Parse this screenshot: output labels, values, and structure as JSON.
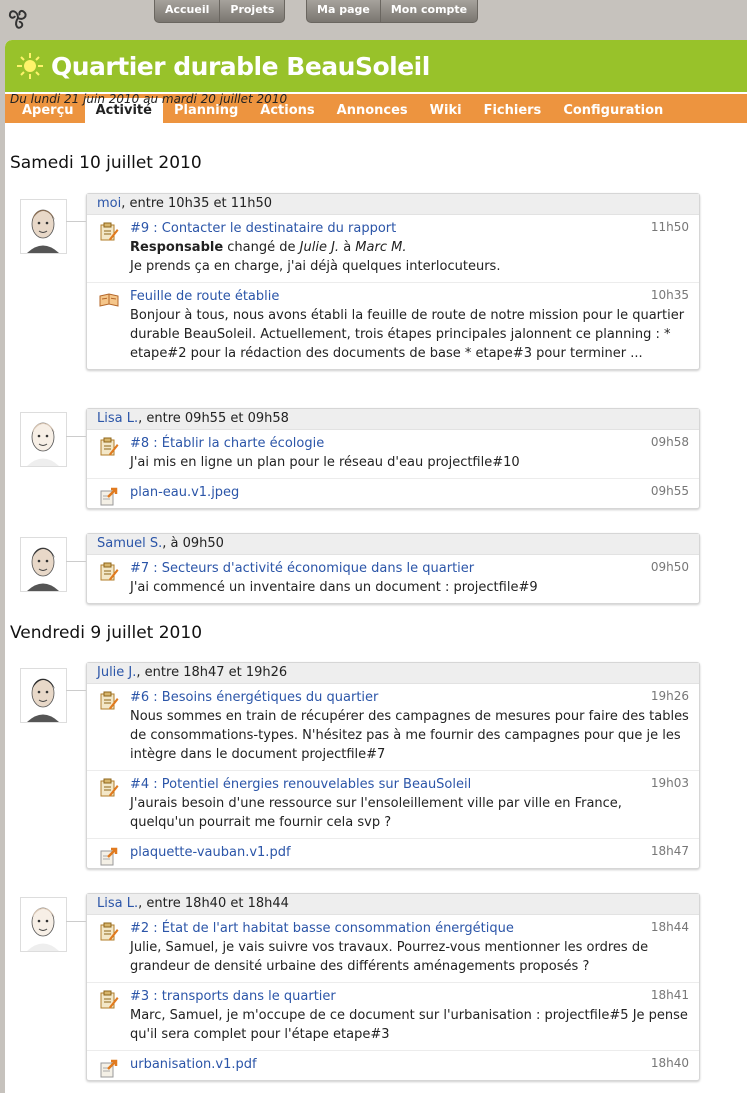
{
  "topnav": {
    "home": "Accueil",
    "projects": "Projets",
    "mypage": "Ma page",
    "account": "Mon compte"
  },
  "header": {
    "title": "Quartier durable BeauSoleil"
  },
  "tabs": [
    "Aperçu",
    "Activité",
    "Planning",
    "Actions",
    "Annonces",
    "Wiki",
    "Fichiers",
    "Configuration"
  ],
  "date_range": "Du lundi 21 juin 2010 au mardi 20 juillet 2010",
  "days": [
    {
      "label": "Samedi 10 juillet 2010",
      "groups": [
        {
          "user": "moi",
          "span": ", entre 10h35 et 11h50",
          "entries": [
            {
              "icon": "task-icon",
              "title": "#9 : Contacter le destinataire du rapport",
              "time": "11h50",
              "change_field": "Responsable",
              "change_from_prefix": " changé de ",
              "change_from": "Julie J.",
              "change_to_prefix": " à ",
              "change_to": "Marc M.",
              "body": "Je prends ça en charge, j'ai déjà quelques interlocuteurs."
            },
            {
              "icon": "roadmap-icon",
              "title": "Feuille de route établie",
              "time": "10h35",
              "body": "Bonjour à tous, nous avons établi la feuille de route de notre mission pour le quartier durable BeauSoleil. Actuellement, trois étapes principales jalonnent ce planning : * etape#2 pour la rédaction des documents de base * etape#3 pour terminer ..."
            }
          ]
        },
        {
          "user": "Lisa L.",
          "span": ", entre 09h55 et 09h58",
          "entries": [
            {
              "icon": "task-icon",
              "title": "#8 : Établir la charte écologie",
              "time": "09h58",
              "body": "J'ai mis en ligne un plan pour le réseau d'eau projectfile#10"
            },
            {
              "icon": "file-icon",
              "title": "plan-eau.v1.jpeg",
              "time": "09h55",
              "body": ""
            }
          ]
        },
        {
          "user": "Samuel S.",
          "span": ", à 09h50",
          "entries": [
            {
              "icon": "task-icon",
              "title": "#7 : Secteurs d'activité économique dans le quartier",
              "time": "09h50",
              "body": "J'ai commencé un inventaire dans un document : projectfile#9"
            }
          ]
        }
      ]
    },
    {
      "label": "Vendredi 9 juillet 2010",
      "groups": [
        {
          "user": "Julie J.",
          "span": ", entre 18h47 et 19h26",
          "entries": [
            {
              "icon": "task-icon",
              "title": "#6 : Besoins énergétiques du quartier",
              "time": "19h26",
              "body": "Nous sommes en train de récupérer des campagnes de mesures pour faire des tables de consommations-types. N'hésitez pas à me fournir des campagnes pour que je les intègre dans le document projectfile#7"
            },
            {
              "icon": "task-icon",
              "title": "#4 : Potentiel énergies renouvelables sur BeauSoleil",
              "time": "19h03",
              "body": "J'aurais besoin d'une ressource sur l'ensoleillement ville par ville en France, quelqu'un pourrait me fournir cela svp ?"
            },
            {
              "icon": "file-icon",
              "title": "plaquette-vauban.v1.pdf",
              "time": "18h47",
              "body": ""
            }
          ]
        },
        {
          "user": "Lisa L.",
          "span": ", entre 18h40 et 18h44",
          "entries": [
            {
              "icon": "task-icon",
              "title": "#2 : État de l'art habitat basse consommation énergétique",
              "time": "18h44",
              "body": "Julie, Samuel, je vais suivre vos travaux. Pourrez-vous mentionner les ordres de grandeur de densité urbaine des différents aménagements proposés ?"
            },
            {
              "icon": "task-icon",
              "title": "#3 : transports dans le quartier",
              "time": "18h41",
              "body": "Marc, Samuel, je m'occupe de ce document sur l'urbanisation : projectfile#5 Je pense qu'il sera complet pour l'étape etape#3"
            },
            {
              "icon": "file-icon",
              "title": "urbanisation.v1.pdf",
              "time": "18h40",
              "body": ""
            }
          ]
        }
      ]
    }
  ]
}
